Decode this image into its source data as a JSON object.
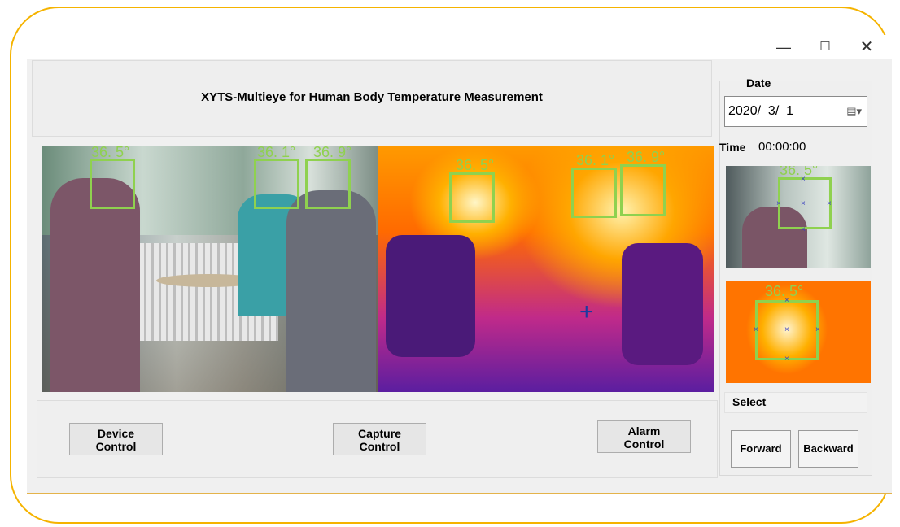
{
  "window": {
    "controls": {
      "minimize": "—",
      "maximize": "☐",
      "close": "✕"
    }
  },
  "header": {
    "title": "XYTS-Multieye for Human Body Temperature Measurement"
  },
  "video": {
    "rgb_temps": [
      "36. 5°",
      "36. 1°",
      "36. 9°"
    ],
    "thermal_temps": [
      "36. 5°",
      "36. 1°",
      "36. 9°"
    ]
  },
  "controls": {
    "device": "Device\nControl",
    "capture": "Capture\nControl",
    "alarm": "Alarm\nControl"
  },
  "sidebar": {
    "date_label": "Date",
    "date_value": "2020/  3/  1",
    "time_label": "Time",
    "time_value": "00:00:00",
    "thumb1_temp": "36. 5°",
    "thumb2_temp": "36. 5°",
    "select_label": "Select",
    "forward": "Forward",
    "backward": "Backward"
  },
  "colors": {
    "accent_frame": "#f5b300",
    "detection_box": "#8fd14f"
  },
  "icons": {
    "calendar": "calendar-dropdown-icon",
    "crosshair": "crosshair-icon"
  }
}
